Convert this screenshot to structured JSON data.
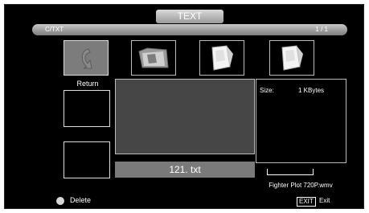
{
  "header": {
    "title": "TEXT",
    "path": "C/TXT",
    "page_indicator": "1 / 1"
  },
  "thumbnails": [
    {
      "name": "return-icon",
      "selected": true
    },
    {
      "name": "folder-icon",
      "selected": false
    },
    {
      "name": "file-icon",
      "selected": false
    },
    {
      "name": "file-icon",
      "selected": false
    }
  ],
  "return_label": "Return",
  "preview": {
    "filename": "121. txt"
  },
  "info": {
    "size_label": "Size:",
    "size_value": "1 KBytes"
  },
  "next_item_name": "Fighter Plot 720P.wmv",
  "footer": {
    "delete_label": "Delete",
    "exit_key": "EXIT",
    "exit_label": "Exit"
  },
  "colors": {
    "background": "#000000",
    "selected_thumb": "#7c7c7c",
    "preview_bg": "#464646",
    "filename_bar": "#7a7a7a"
  }
}
